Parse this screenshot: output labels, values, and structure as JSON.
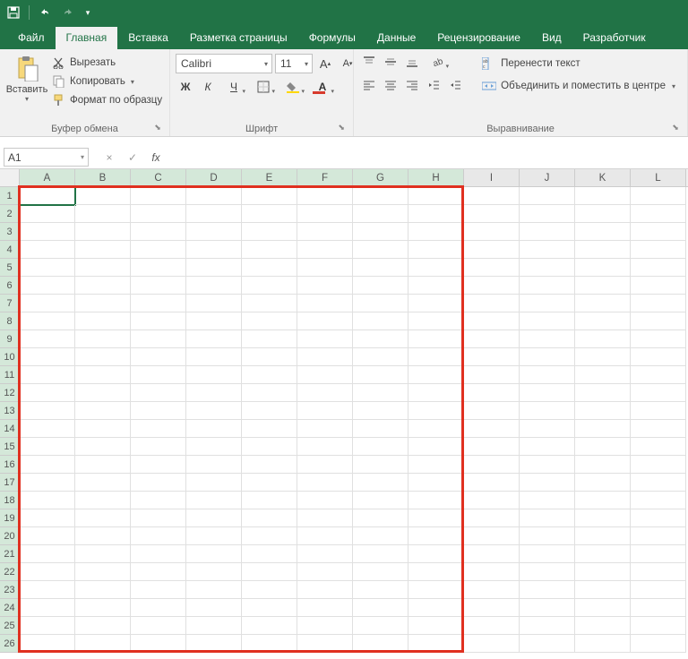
{
  "qat": {
    "save": "save",
    "undo": "undo",
    "redo": "redo"
  },
  "tabs": {
    "file": "Файл",
    "home": "Главная",
    "insert": "Вставка",
    "layout": "Разметка страницы",
    "formulas": "Формулы",
    "data": "Данные",
    "review": "Рецензирование",
    "view": "Вид",
    "developer": "Разработчик"
  },
  "clipboard": {
    "paste": "Вставить",
    "cut": "Вырезать",
    "copy": "Копировать",
    "format_painter": "Формат по образцу",
    "group_label": "Буфер обмена"
  },
  "font": {
    "name": "Calibri",
    "size": "11",
    "bold": "Ж",
    "italic": "К",
    "underline": "Ч",
    "group_label": "Шрифт"
  },
  "alignment": {
    "wrap": "Перенести текст",
    "merge": "Объединить и поместить в центре",
    "group_label": "Выравнивание"
  },
  "formula_bar": {
    "name_box": "A1",
    "cancel": "×",
    "confirm": "✓",
    "fx": "fx",
    "value": ""
  },
  "grid": {
    "columns": [
      "A",
      "B",
      "C",
      "D",
      "E",
      "F",
      "G",
      "H",
      "I",
      "J",
      "K",
      "L"
    ],
    "rows": [
      1,
      2,
      3,
      4,
      5,
      6,
      7,
      8,
      9,
      10,
      11,
      12,
      13,
      14,
      15,
      16,
      17,
      18,
      19,
      20,
      21,
      22,
      23,
      24,
      25,
      26
    ],
    "active_cell": "A1",
    "selection_box": {
      "from_col": "A",
      "to_col": "H",
      "from_row": 1,
      "to_row": 26
    }
  },
  "font_size_lbl_inc": "A",
  "font_size_lbl_dec": "A"
}
